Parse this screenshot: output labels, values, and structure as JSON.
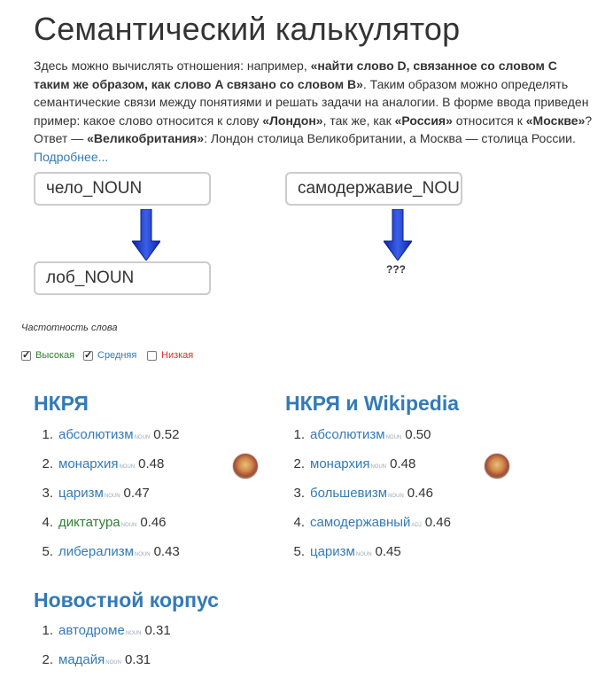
{
  "title": "Семантический калькулятор",
  "description": {
    "p1": "Здесь можно вычислять отношения: например, ",
    "b1": "«найти слово D, связанное со словом C таким же образом, как слово A связано со словом B»",
    "p2": ". Таким образом можно определять семантические связи между понятиями и решать задачи на аналогии. В форме ввода приведен пример: какое слово относится к слову ",
    "b2": "«Лондон»",
    "p3": ", так же, как ",
    "b3": "«Россия»",
    "p4": " относится к ",
    "b4": "«Москве»",
    "p5": "? Ответ — ",
    "b5": "«Великобритания»",
    "p6": ": Лондон столица Великобритании, а Москва — столица России. ",
    "more": "Подробнее..."
  },
  "inputs": {
    "a": "чело_NOUN",
    "b": "лоб_NOUN",
    "c": "самодержавие_NOUN"
  },
  "result_placeholder": "???",
  "frequency": {
    "label": "Частотность слова",
    "high": {
      "label": "Высокая",
      "checked": true,
      "color": "#2e7d32"
    },
    "medium": {
      "label": "Средняя",
      "checked": true,
      "color": "#337ab7"
    },
    "low": {
      "label": "Низкая",
      "checked": false,
      "color": "#d32f2f"
    }
  },
  "sections": {
    "nkrya": {
      "title": "НКРЯ",
      "items": [
        {
          "n": "1.",
          "word": "абсолютизм",
          "pos": "NOUN",
          "score": "0.52"
        },
        {
          "n": "2.",
          "word": "монархия",
          "pos": "NOUN",
          "score": "0.48"
        },
        {
          "n": "3.",
          "word": "царизм",
          "pos": "NOUN",
          "score": "0.47"
        },
        {
          "n": "4.",
          "word": "диктатура",
          "pos": "NOUN",
          "score": "0.46"
        },
        {
          "n": "5.",
          "word": "либерализм",
          "pos": "NOUN",
          "score": "0.43"
        }
      ]
    },
    "nkrya_wiki": {
      "title": "НКРЯ и Wikipedia",
      "items": [
        {
          "n": "1.",
          "word": "абсолютизм",
          "pos": "NOUN",
          "score": "0.50"
        },
        {
          "n": "2.",
          "word": "монархия",
          "pos": "NOUN",
          "score": "0.48"
        },
        {
          "n": "3.",
          "word": "большевизм",
          "pos": "NOUN",
          "score": "0.46"
        },
        {
          "n": "4.",
          "word": "самодержавный",
          "pos": "ADJ",
          "score": "0.46"
        },
        {
          "n": "5.",
          "word": "царизм",
          "pos": "NOUN",
          "score": "0.45"
        }
      ]
    },
    "news": {
      "title": "Новостной корпус",
      "items": [
        {
          "n": "1.",
          "word": "автодроме",
          "pos": "NOUN",
          "score": "0.31"
        },
        {
          "n": "2.",
          "word": "мадайя",
          "pos": "NOUN",
          "score": "0.31"
        }
      ]
    }
  },
  "colors": {
    "accent": "#337ab7",
    "arrow": "#1f3fbf",
    "high": "#2e7d32",
    "low": "#d32f2f"
  }
}
